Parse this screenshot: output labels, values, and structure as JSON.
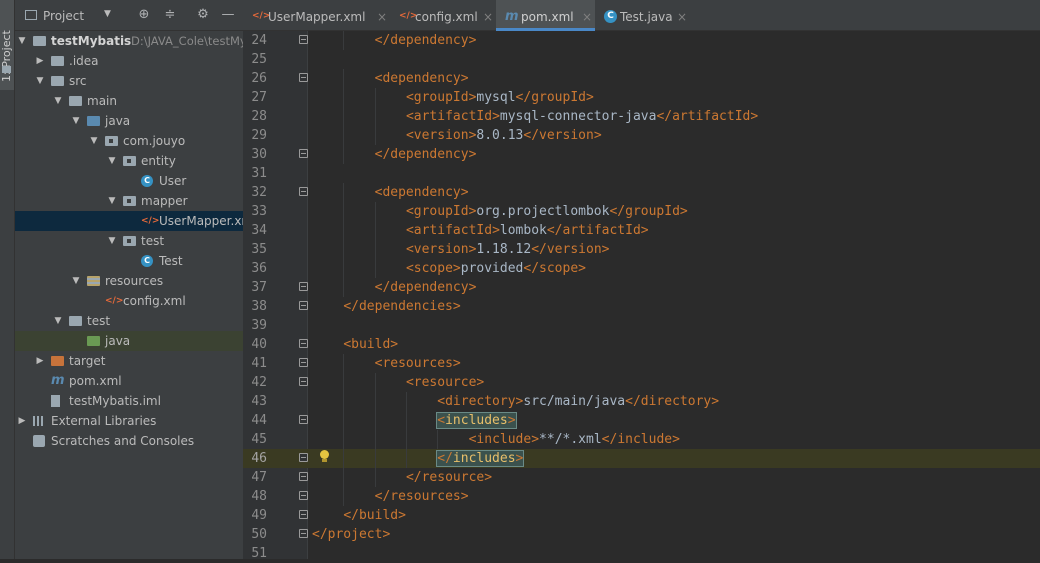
{
  "toolstrip": {
    "project_tab": "1: Project"
  },
  "project_panel": {
    "title": "Project",
    "tree": [
      {
        "label": "testMybatis",
        "path": "D:\\JAVA_Cole\\testMyb",
        "depth": 0,
        "arrow": "▼",
        "icon": "folder",
        "bold": true
      },
      {
        "label": ".idea",
        "depth": 1,
        "arrow": "▶",
        "icon": "folder"
      },
      {
        "label": "src",
        "depth": 1,
        "arrow": "▼",
        "icon": "folder"
      },
      {
        "label": "main",
        "depth": 2,
        "arrow": "▼",
        "icon": "folder"
      },
      {
        "label": "java",
        "depth": 3,
        "arrow": "▼",
        "icon": "source-folder"
      },
      {
        "label": "com.jouyo",
        "depth": 4,
        "arrow": "▼",
        "icon": "package"
      },
      {
        "label": "entity",
        "depth": 5,
        "arrow": "▼",
        "icon": "package"
      },
      {
        "label": "User",
        "depth": 6,
        "arrow": "",
        "icon": "class"
      },
      {
        "label": "mapper",
        "depth": 5,
        "arrow": "▼",
        "icon": "package"
      },
      {
        "label": "UserMapper.xml",
        "depth": 6,
        "arrow": "",
        "icon": "xml",
        "selected": true
      },
      {
        "label": "test",
        "depth": 5,
        "arrow": "▼",
        "icon": "package"
      },
      {
        "label": "Test",
        "depth": 6,
        "arrow": "",
        "icon": "class"
      },
      {
        "label": "resources",
        "depth": 3,
        "arrow": "▼",
        "icon": "resources-folder"
      },
      {
        "label": "config.xml",
        "depth": 4,
        "arrow": "",
        "icon": "xml"
      },
      {
        "label": "test",
        "depth": 2,
        "arrow": "▼",
        "icon": "folder"
      },
      {
        "label": "java",
        "depth": 3,
        "arrow": "",
        "icon": "test-folder",
        "highlight": true
      },
      {
        "label": "target",
        "depth": 1,
        "arrow": "▶",
        "icon": "excluded-folder"
      },
      {
        "label": "pom.xml",
        "depth": 1,
        "arrow": "",
        "icon": "maven"
      },
      {
        "label": "testMybatis.iml",
        "depth": 1,
        "arrow": "",
        "icon": "file"
      },
      {
        "label": "External Libraries",
        "depth": 0,
        "arrow": "▶",
        "icon": "library"
      },
      {
        "label": "Scratches and Consoles",
        "depth": 0,
        "arrow": "",
        "icon": "scratch"
      }
    ]
  },
  "tabs": [
    {
      "label": "UserMapper.xml",
      "icon": "xml",
      "active": false
    },
    {
      "label": "config.xml",
      "icon": "xml",
      "active": false
    },
    {
      "label": "pom.xml",
      "icon": "maven",
      "active": true
    },
    {
      "label": "Test.java",
      "icon": "class",
      "active": false
    }
  ],
  "editor": {
    "current_line": 46,
    "lines": [
      {
        "n": "24",
        "indent": 2,
        "tokens": [
          [
            "tg",
            "</"
          ],
          [
            "tg",
            "dependency"
          ],
          [
            "tg",
            ">"
          ]
        ]
      },
      {
        "n": "25",
        "indent": 0,
        "tokens": []
      },
      {
        "n": "26",
        "indent": 2,
        "tokens": [
          [
            "tg",
            "<"
          ],
          [
            "tg",
            "dependency"
          ],
          [
            "tg",
            ">"
          ]
        ]
      },
      {
        "n": "27",
        "indent": 3,
        "tokens": [
          [
            "tg",
            "<"
          ],
          [
            "tg",
            "groupId"
          ],
          [
            "tg",
            ">"
          ],
          [
            "tx",
            "mysql"
          ],
          [
            "tg",
            "</"
          ],
          [
            "tg",
            "groupId"
          ],
          [
            "tg",
            ">"
          ]
        ]
      },
      {
        "n": "28",
        "indent": 3,
        "tokens": [
          [
            "tg",
            "<"
          ],
          [
            "tg",
            "artifactId"
          ],
          [
            "tg",
            ">"
          ],
          [
            "tx",
            "mysql-connector-java"
          ],
          [
            "tg",
            "</"
          ],
          [
            "tg",
            "artifactId"
          ],
          [
            "tg",
            ">"
          ]
        ]
      },
      {
        "n": "29",
        "indent": 3,
        "tokens": [
          [
            "tg",
            "<"
          ],
          [
            "tg",
            "version"
          ],
          [
            "tg",
            ">"
          ],
          [
            "tx",
            "8.0.13"
          ],
          [
            "tg",
            "</"
          ],
          [
            "tg",
            "version"
          ],
          [
            "tg",
            ">"
          ]
        ]
      },
      {
        "n": "30",
        "indent": 2,
        "tokens": [
          [
            "tg",
            "</"
          ],
          [
            "tg",
            "dependency"
          ],
          [
            "tg",
            ">"
          ]
        ]
      },
      {
        "n": "31",
        "indent": 0,
        "tokens": []
      },
      {
        "n": "32",
        "indent": 2,
        "tokens": [
          [
            "tg",
            "<"
          ],
          [
            "tg",
            "dependency"
          ],
          [
            "tg",
            ">"
          ]
        ]
      },
      {
        "n": "33",
        "indent": 3,
        "tokens": [
          [
            "tg",
            "<"
          ],
          [
            "tg",
            "groupId"
          ],
          [
            "tg",
            ">"
          ],
          [
            "tx",
            "org.projectlombok"
          ],
          [
            "tg",
            "</"
          ],
          [
            "tg",
            "groupId"
          ],
          [
            "tg",
            ">"
          ]
        ]
      },
      {
        "n": "34",
        "indent": 3,
        "tokens": [
          [
            "tg",
            "<"
          ],
          [
            "tg",
            "artifactId"
          ],
          [
            "tg",
            ">"
          ],
          [
            "tx",
            "lombok"
          ],
          [
            "tg",
            "</"
          ],
          [
            "tg",
            "artifactId"
          ],
          [
            "tg",
            ">"
          ]
        ]
      },
      {
        "n": "35",
        "indent": 3,
        "tokens": [
          [
            "tg",
            "<"
          ],
          [
            "tg",
            "version"
          ],
          [
            "tg",
            ">"
          ],
          [
            "tx",
            "1.18.12"
          ],
          [
            "tg",
            "</"
          ],
          [
            "tg",
            "version"
          ],
          [
            "tg",
            ">"
          ]
        ]
      },
      {
        "n": "36",
        "indent": 3,
        "tokens": [
          [
            "tg",
            "<"
          ],
          [
            "tg",
            "scope"
          ],
          [
            "tg",
            ">"
          ],
          [
            "tx",
            "provided"
          ],
          [
            "tg",
            "</"
          ],
          [
            "tg",
            "scope"
          ],
          [
            "tg",
            ">"
          ]
        ]
      },
      {
        "n": "37",
        "indent": 2,
        "tokens": [
          [
            "tg",
            "</"
          ],
          [
            "tg",
            "dependency"
          ],
          [
            "tg",
            ">"
          ]
        ]
      },
      {
        "n": "38",
        "indent": 1,
        "tokens": [
          [
            "tg",
            "</"
          ],
          [
            "tg",
            "dependencies"
          ],
          [
            "tg",
            ">"
          ]
        ]
      },
      {
        "n": "39",
        "indent": 0,
        "tokens": []
      },
      {
        "n": "40",
        "indent": 1,
        "tokens": [
          [
            "tg",
            "<"
          ],
          [
            "tg",
            "build"
          ],
          [
            "tg",
            ">"
          ]
        ]
      },
      {
        "n": "41",
        "indent": 2,
        "tokens": [
          [
            "tg",
            "<"
          ],
          [
            "tg",
            "resources"
          ],
          [
            "tg",
            ">"
          ]
        ]
      },
      {
        "n": "42",
        "indent": 3,
        "tokens": [
          [
            "tg",
            "<"
          ],
          [
            "tg",
            "resource"
          ],
          [
            "tg",
            ">"
          ]
        ]
      },
      {
        "n": "43",
        "indent": 4,
        "tokens": [
          [
            "tg",
            "<"
          ],
          [
            "tg",
            "directory"
          ],
          [
            "tg",
            ">"
          ],
          [
            "tx",
            "src/main/java"
          ],
          [
            "tg",
            "</"
          ],
          [
            "tg",
            "directory"
          ],
          [
            "tg",
            ">"
          ]
        ]
      },
      {
        "n": "44",
        "indent": 4,
        "match": true,
        "tokens": [
          [
            "tg",
            "<"
          ],
          [
            "t",
            "includes"
          ],
          [
            "tg",
            ">"
          ]
        ]
      },
      {
        "n": "45",
        "indent": 5,
        "tokens": [
          [
            "tg",
            "<"
          ],
          [
            "tg",
            "include"
          ],
          [
            "tg",
            ">"
          ],
          [
            "tx",
            "**/*.xml"
          ],
          [
            "tg",
            "</"
          ],
          [
            "tg",
            "include"
          ],
          [
            "tg",
            ">"
          ]
        ]
      },
      {
        "n": "46",
        "indent": 4,
        "match": true,
        "tokens": [
          [
            "tg",
            "</"
          ],
          [
            "t",
            "includes"
          ],
          [
            "tg",
            ">"
          ]
        ]
      },
      {
        "n": "47",
        "indent": 3,
        "tokens": [
          [
            "tg",
            "</"
          ],
          [
            "tg",
            "resource"
          ],
          [
            "tg",
            ">"
          ]
        ]
      },
      {
        "n": "48",
        "indent": 2,
        "tokens": [
          [
            "tg",
            "</"
          ],
          [
            "tg",
            "resources"
          ],
          [
            "tg",
            ">"
          ]
        ]
      },
      {
        "n": "49",
        "indent": 1,
        "tokens": [
          [
            "tg",
            "</"
          ],
          [
            "tg",
            "build"
          ],
          [
            "tg",
            ">"
          ]
        ]
      },
      {
        "n": "50",
        "indent": 0,
        "tokens": [
          [
            "tg",
            "</"
          ],
          [
            "tg",
            "project"
          ],
          [
            "tg",
            ">"
          ]
        ]
      },
      {
        "n": "51",
        "indent": 0,
        "tokens": []
      }
    ],
    "fold_lines": [
      "24",
      "26",
      "30",
      "32",
      "37",
      "38",
      "40",
      "41",
      "42",
      "44",
      "46",
      "47",
      "48",
      "49",
      "50"
    ],
    "bulb_line": "46"
  },
  "colors": {
    "tag": "#e8bf6a",
    "bracket": "#cc7832",
    "text": "#a9b7c6",
    "selection": "#0d293e",
    "accent": "#4a88c7"
  }
}
